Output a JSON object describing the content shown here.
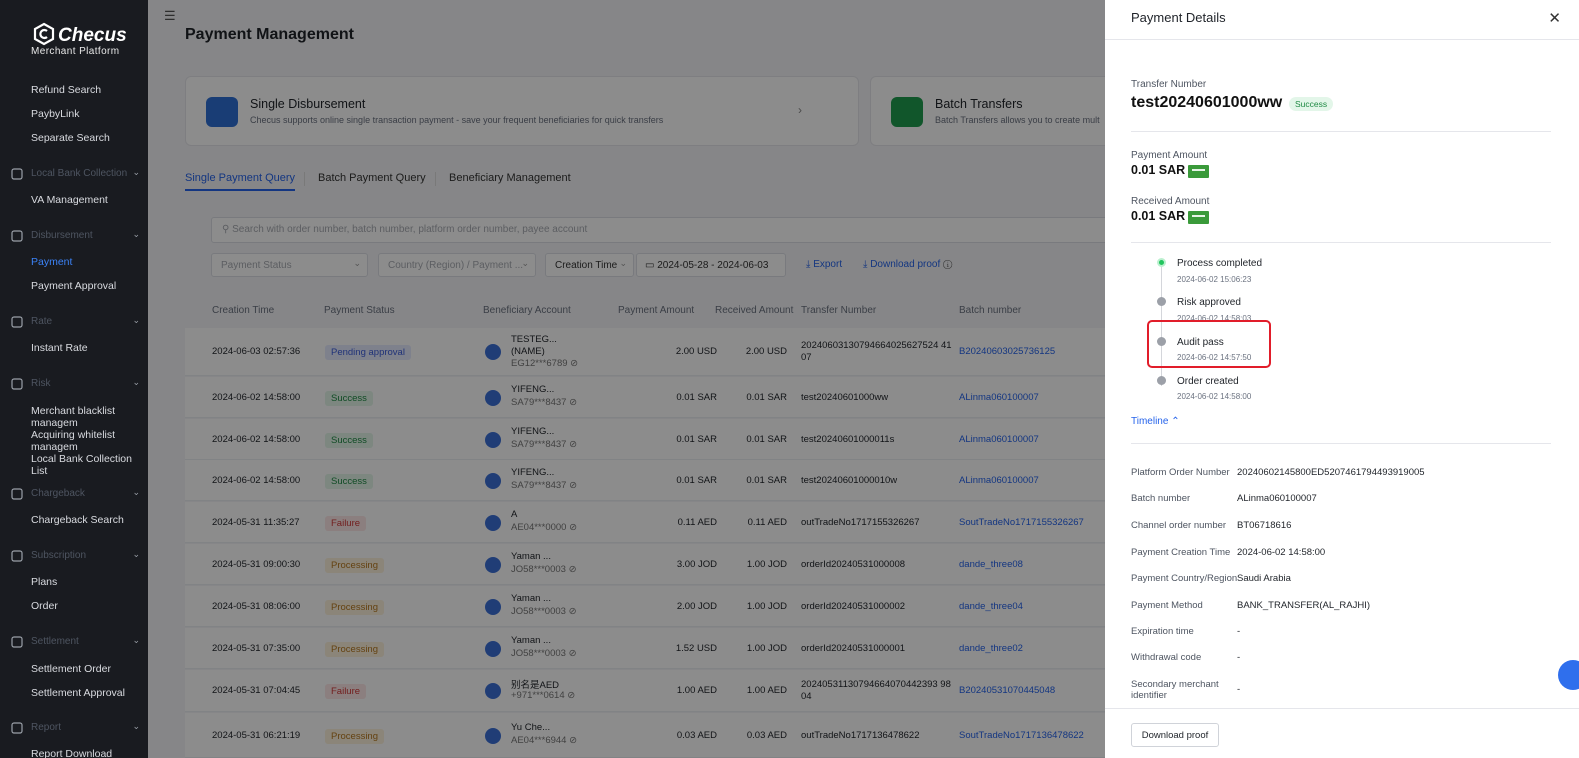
{
  "logo": {
    "brand": "Checus",
    "subtitle": "Merchant   Platform"
  },
  "sidebar": {
    "items": [
      {
        "label": "Refund Search",
        "type": "item"
      },
      {
        "label": "PaybyLink",
        "type": "item"
      },
      {
        "label": "Separate Search",
        "type": "item"
      },
      {
        "label": "Local Bank Collection",
        "type": "group"
      },
      {
        "label": "VA Management",
        "type": "item"
      },
      {
        "label": "Disbursement",
        "type": "group"
      },
      {
        "label": "Payment",
        "type": "item",
        "active": true
      },
      {
        "label": "Payment Approval",
        "type": "item"
      },
      {
        "label": "Rate",
        "type": "group"
      },
      {
        "label": "Instant Rate",
        "type": "item"
      },
      {
        "label": "Risk",
        "type": "group"
      },
      {
        "label": "Merchant blacklist managem",
        "type": "item"
      },
      {
        "label": "Acquiring whitelist managem",
        "type": "item"
      },
      {
        "label": "Local Bank Collection List",
        "type": "item"
      },
      {
        "label": "Chargeback",
        "type": "group"
      },
      {
        "label": "Chargeback Search",
        "type": "item"
      },
      {
        "label": "Subscription",
        "type": "group"
      },
      {
        "label": "Plans",
        "type": "item"
      },
      {
        "label": "Order",
        "type": "item"
      },
      {
        "label": "Settlement",
        "type": "group"
      },
      {
        "label": "Settlement Order",
        "type": "item"
      },
      {
        "label": "Settlement Approval",
        "type": "item"
      },
      {
        "label": "Report",
        "type": "group"
      },
      {
        "label": "Report Download",
        "type": "item"
      }
    ]
  },
  "main": {
    "title": "Payment Management",
    "cards": [
      {
        "title": "Single Disbursement",
        "desc": "Checus supports online single transaction payment - save your frequent beneficiaries for quick transfers"
      },
      {
        "title": "Batch Transfers",
        "desc": "Batch Transfers allows you to create mult"
      }
    ],
    "tabs": [
      "Single Payment Query",
      "Batch Payment Query",
      "Beneficiary Management"
    ],
    "search_placeholder": "Search with order number, batch number, platform order number, payee account",
    "filters": {
      "payment_status": "Payment Status",
      "country": "Country (Region) / Payment ...",
      "creation_time": "Creation Time",
      "date_range": "2024-05-28  -  2024-06-03",
      "export": "Export",
      "download_proof": "Download proof"
    },
    "columns": [
      "Creation Time",
      "Payment Status",
      "Beneficiary Account",
      "Payment Amount",
      "Received Amount",
      "Transfer Number",
      "Batch number"
    ],
    "rows": [
      {
        "time": "2024-06-03 02:57:36",
        "status": "Pending approval",
        "status_class": "pending",
        "name1": "TESTEG...",
        "name2": "(NAME)",
        "acct": "EG12***6789 ⊘",
        "pay": "2.00 USD",
        "recv": "2.00 USD",
        "transfer1": "20240603130794664025627524 41",
        "transfer2": "07",
        "batch": "B20240603025736125"
      },
      {
        "time": "2024-06-02 14:58:00",
        "status": "Success",
        "status_class": "success",
        "name1": "YIFENG...",
        "name2": "",
        "acct": "SA79***8437 ⊘",
        "pay": "0.01 SAR",
        "recv": "0.01 SAR",
        "transfer1": "test20240601000ww",
        "transfer2": "",
        "batch": "ALinma060100007"
      },
      {
        "time": "2024-06-02 14:58:00",
        "status": "Success",
        "status_class": "success",
        "name1": "YIFENG...",
        "name2": "",
        "acct": "SA79***8437 ⊘",
        "pay": "0.01 SAR",
        "recv": "0.01 SAR",
        "transfer1": "test20240601000011s",
        "transfer2": "",
        "batch": "ALinma060100007"
      },
      {
        "time": "2024-06-02 14:58:00",
        "status": "Success",
        "status_class": "success",
        "name1": "YIFENG...",
        "name2": "",
        "acct": "SA79***8437 ⊘",
        "pay": "0.01 SAR",
        "recv": "0.01 SAR",
        "transfer1": "test20240601000010w",
        "transfer2": "",
        "batch": "ALinma060100007"
      },
      {
        "time": "2024-05-31 11:35:27",
        "status": "Failure",
        "status_class": "failure",
        "name1": "A",
        "name2": "",
        "acct": "AE04***0000 ⊘",
        "pay": "0.11 AED",
        "recv": "0.11 AED",
        "transfer1": "outTradeNo1717155326267",
        "transfer2": "",
        "batch": "SoutTradeNo1717155326267"
      },
      {
        "time": "2024-05-31 09:00:30",
        "status": "Processing",
        "status_class": "processing",
        "name1": "Yaman ...",
        "name2": "",
        "acct": "JO58***0003 ⊘",
        "pay": "3.00 JOD",
        "recv": "1.00 JOD",
        "transfer1": "orderId20240531000008",
        "transfer2": "",
        "batch": "dande_three08"
      },
      {
        "time": "2024-05-31 08:06:00",
        "status": "Processing",
        "status_class": "processing",
        "name1": "Yaman ...",
        "name2": "",
        "acct": "JO58***0003 ⊘",
        "pay": "2.00 JOD",
        "recv": "1.00 JOD",
        "transfer1": "orderId20240531000002",
        "transfer2": "",
        "batch": "dande_three04"
      },
      {
        "time": "2024-05-31 07:35:00",
        "status": "Processing",
        "status_class": "processing",
        "name1": "Yaman ...",
        "name2": "",
        "acct": "JO58***0003 ⊘",
        "pay": "1.52 USD",
        "recv": "1.00 JOD",
        "transfer1": "orderId20240531000001",
        "transfer2": "",
        "batch": "dande_three02"
      },
      {
        "time": "2024-05-31 07:04:45",
        "status": "Failure",
        "status_class": "failure",
        "name1": "别名是AED",
        "name2": "",
        "acct": "+971***0614 ⊘",
        "pay": "1.00 AED",
        "recv": "1.00 AED",
        "transfer1": "20240531130794664070442393 98",
        "transfer2": "04",
        "batch": "B20240531070445048"
      },
      {
        "time": "2024-05-31 06:21:19",
        "status": "Processing",
        "status_class": "processing",
        "name1": "Yu Che...",
        "name2": "",
        "acct": "AE04***6944 ⊘",
        "pay": "0.03 AED",
        "recv": "0.03 AED",
        "transfer1": "outTradeNo1717136478622",
        "transfer2": "",
        "batch": "SoutTradeNo1717136478622"
      }
    ]
  },
  "drawer": {
    "title": "Payment Details",
    "transfer_label": "Transfer Number",
    "transfer_number": "test20240601000ww",
    "status_badge": "Success",
    "payment_amount_label": "Payment Amount",
    "payment_amount": "0.01 SAR",
    "received_amount_label": "Received Amount",
    "received_amount": "0.01 SAR",
    "timeline": [
      {
        "title": "Process completed",
        "time": "2024-06-02 15:06:23"
      },
      {
        "title": "Risk approved",
        "time": "2024-06-02 14:58:03"
      },
      {
        "title": "Audit pass",
        "time": "2024-06-02 14:57:50"
      },
      {
        "title": "Order created",
        "time": "2024-06-02 14:58:00"
      }
    ],
    "timeline_toggle": "Timeline",
    "details": [
      {
        "key": "Platform Order Number",
        "value": "20240602145800ED5207461794493919005"
      },
      {
        "key": "Batch number",
        "value": "ALinma060100007"
      },
      {
        "key": "Channel order number",
        "value": "BT06718616"
      },
      {
        "key": "Payment Creation Time",
        "value": "2024-06-02 14:58:00"
      },
      {
        "key": "Payment Country/Region",
        "value": "Saudi Arabia"
      },
      {
        "key": "Payment Method",
        "value": "BANK_TRANSFER(AL_RAJHI)"
      },
      {
        "key": "Expiration time",
        "value": "-"
      },
      {
        "key": "Withdrawal code",
        "value": "-"
      },
      {
        "key": "Secondary merchant identifier",
        "value": "-"
      }
    ],
    "download_button": "Download proof"
  }
}
